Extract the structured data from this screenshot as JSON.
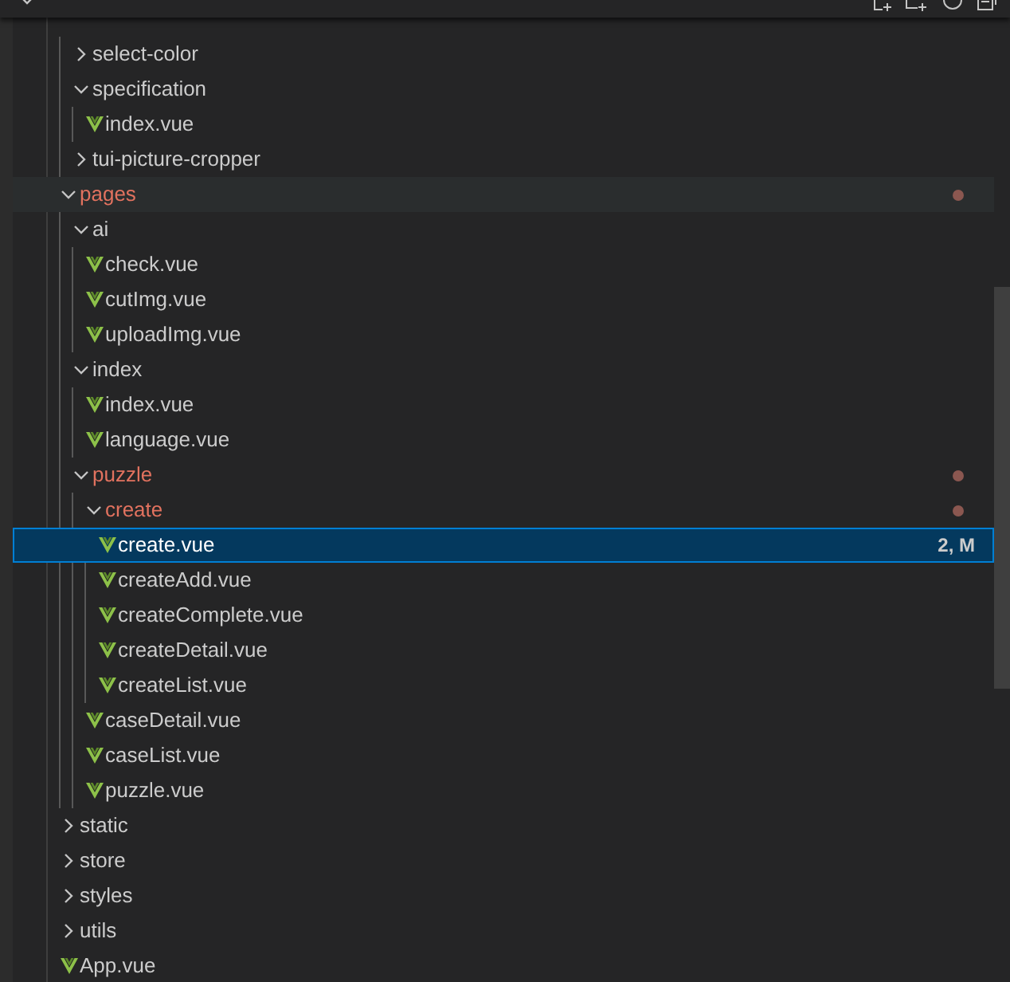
{
  "explorer": {
    "expanded": true
  },
  "tree": [
    {
      "kind": "offscreen_folder",
      "children": [
        {
          "kind": "folder",
          "name": "select-color",
          "expanded": false,
          "modified": false,
          "selected": false,
          "hovered": false
        },
        {
          "kind": "folder",
          "name": "specification",
          "expanded": true,
          "modified": false,
          "selected": false,
          "hovered": false,
          "children": [
            {
              "kind": "vue",
              "name": "index.vue",
              "modified": false,
              "selected": false,
              "hovered": false
            }
          ]
        },
        {
          "kind": "folder",
          "name": "tui-picture-cropper",
          "expanded": false,
          "modified": false,
          "selected": false,
          "hovered": false
        }
      ]
    },
    {
      "kind": "folder",
      "name": "pages",
      "expanded": true,
      "modified": true,
      "selected": false,
      "hovered": true,
      "children": [
        {
          "kind": "folder",
          "name": "ai",
          "expanded": true,
          "modified": false,
          "selected": false,
          "hovered": false,
          "children": [
            {
              "kind": "vue",
              "name": "check.vue",
              "modified": false,
              "selected": false,
              "hovered": false
            },
            {
              "kind": "vue",
              "name": "cutImg.vue",
              "modified": false,
              "selected": false,
              "hovered": false
            },
            {
              "kind": "vue",
              "name": "uploadImg.vue",
              "modified": false,
              "selected": false,
              "hovered": false
            }
          ]
        },
        {
          "kind": "folder",
          "name": "index",
          "expanded": true,
          "modified": false,
          "selected": false,
          "hovered": false,
          "children": [
            {
              "kind": "vue",
              "name": "index.vue",
              "modified": false,
              "selected": false,
              "hovered": false
            },
            {
              "kind": "vue",
              "name": "language.vue",
              "modified": false,
              "selected": false,
              "hovered": false
            }
          ]
        },
        {
          "kind": "folder",
          "name": "puzzle",
          "expanded": true,
          "modified": true,
          "selected": false,
          "hovered": false,
          "children": [
            {
              "kind": "folder",
              "name": "create",
              "expanded": true,
              "modified": true,
              "selected": false,
              "hovered": false,
              "children": [
                {
                  "kind": "vue",
                  "name": "create.vue",
                  "modified": true,
                  "badge": "2, M",
                  "selected": true,
                  "hovered": false
                },
                {
                  "kind": "vue",
                  "name": "createAdd.vue",
                  "modified": false,
                  "selected": false,
                  "hovered": false
                },
                {
                  "kind": "vue",
                  "name": "createComplete.vue",
                  "modified": false,
                  "selected": false,
                  "hovered": false
                },
                {
                  "kind": "vue",
                  "name": "createDetail.vue",
                  "modified": false,
                  "selected": false,
                  "hovered": false
                },
                {
                  "kind": "vue",
                  "name": "createList.vue",
                  "modified": false,
                  "selected": false,
                  "hovered": false
                }
              ]
            },
            {
              "kind": "vue",
              "name": "caseDetail.vue",
              "modified": false,
              "selected": false,
              "hovered": false
            },
            {
              "kind": "vue",
              "name": "caseList.vue",
              "modified": false,
              "selected": false,
              "hovered": false
            },
            {
              "kind": "vue",
              "name": "puzzle.vue",
              "modified": false,
              "selected": false,
              "hovered": false
            }
          ]
        }
      ]
    },
    {
      "kind": "folder",
      "name": "static",
      "expanded": false,
      "modified": false,
      "selected": false,
      "hovered": false
    },
    {
      "kind": "folder",
      "name": "store",
      "expanded": false,
      "modified": false,
      "selected": false,
      "hovered": false
    },
    {
      "kind": "folder",
      "name": "styles",
      "expanded": false,
      "modified": false,
      "selected": false,
      "hovered": false
    },
    {
      "kind": "folder",
      "name": "utils",
      "expanded": false,
      "modified": false,
      "selected": false,
      "hovered": false
    },
    {
      "kind": "vue",
      "name": "App.vue",
      "modified": false,
      "selected": false,
      "hovered": false
    }
  ]
}
